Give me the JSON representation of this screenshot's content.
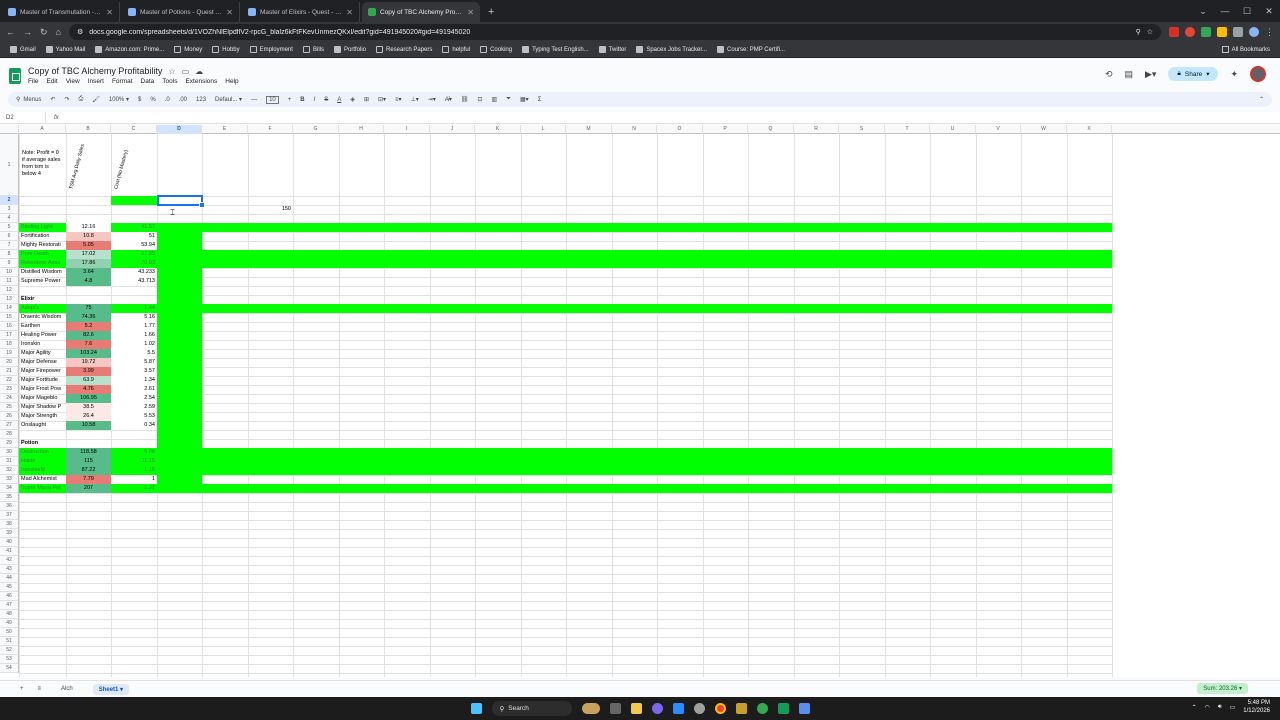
{
  "browser": {
    "tabs": [
      {
        "label": "Master of Transmutation - Que",
        "active": false
      },
      {
        "label": "Master of Potions - Quest - TB",
        "active": false
      },
      {
        "label": "Master of Elixirs - Quest - TBC",
        "active": false
      },
      {
        "label": "Copy of TBC Alchemy Profitabili",
        "active": true
      }
    ],
    "url": "docs.google.com/spreadsheets/d/1VOZhNlElpdflV2-rpcG_blalz6kFtFKevUnmezQKxI/edit?gid=491945020#gid=491945020",
    "bookmarks": [
      "Gmail",
      "Yahoo Mail",
      "Amazon.com: Prime...",
      "Money",
      "Hobby",
      "Employment",
      "Bills",
      "Portfolio",
      "Research Papers",
      "helpful",
      "Cooking",
      "Typing Test English...",
      "Twitter",
      "Spacex Jobs Tracker...",
      "Course: PMP Certifi..."
    ],
    "all_bookmarks": "All Bookmarks"
  },
  "sheets": {
    "title": "Copy of TBC Alchemy Profitability",
    "menu": [
      "File",
      "Edit",
      "View",
      "Insert",
      "Format",
      "Data",
      "Tools",
      "Extensions",
      "Help"
    ],
    "share_label": "Share",
    "toolbar": {
      "menus": "Menus",
      "zoom": "100%",
      "currency": "$",
      "percent": "%",
      "dec_dec": ".0",
      "dec_inc": ".00",
      "numfmt": "123",
      "font": "Defaul...",
      "font_size": "10"
    },
    "name_box": "D2",
    "fx": "fx",
    "columns": [
      "A",
      "B",
      "C",
      "D",
      "E",
      "F",
      "G",
      "H",
      "I",
      "J",
      "K",
      "L",
      "M",
      "N",
      "O",
      "P",
      "Q",
      "R",
      "S",
      "T",
      "U",
      "V",
      "W",
      "X"
    ],
    "headers": {
      "note": [
        "Note: Profit = 0",
        "if average sales",
        "from tsm is",
        "below 4"
      ],
      "b": "TSM Avg Daily Sales",
      "c": "Cost (No Mastery)"
    },
    "f3_value": "150",
    "rows": [
      {
        "r": 5,
        "a": "Binding Light",
        "b": "12.16",
        "c": "41.57"
      },
      {
        "r": 6,
        "a": "Fortification",
        "b": "10.8",
        "c": "51"
      },
      {
        "r": 7,
        "a": "Mighty Restorati",
        "b": "5.05",
        "c": "53.94"
      },
      {
        "r": 8,
        "a": "Pure Death",
        "b": "17.02",
        "c": "57.85"
      },
      {
        "r": 9,
        "a": "Relentless Assa",
        "b": "17.86",
        "c": "70.93"
      },
      {
        "r": 10,
        "a": "Distilled Wisdom",
        "b": "3.64",
        "c": "43.233"
      },
      {
        "r": 11,
        "a": "Supreme Power",
        "b": "4.8",
        "c": "43.713"
      },
      {
        "r": 13,
        "a": "Elixir",
        "b": "",
        "c": ""
      },
      {
        "r": 14,
        "a": "Adept's",
        "b": "75",
        "c": "1.44"
      },
      {
        "r": 15,
        "a": "Draenic Wisdom",
        "b": "74.36",
        "c": "5.16"
      },
      {
        "r": 16,
        "a": "Earthen",
        "b": "5.2",
        "c": "1.77"
      },
      {
        "r": 17,
        "a": "Healing Power",
        "b": "82.6",
        "c": "1.66"
      },
      {
        "r": 18,
        "a": "Ironskin",
        "b": "7.6",
        "c": "1.02"
      },
      {
        "r": 19,
        "a": "Major Agility",
        "b": "103.24",
        "c": "5.5"
      },
      {
        "r": 20,
        "a": "Major Defense",
        "b": "19.72",
        "c": "5.87"
      },
      {
        "r": 21,
        "a": "Major Firepower",
        "b": "3.99",
        "c": "3.57"
      },
      {
        "r": 22,
        "a": "Major Fortitude",
        "b": "63.9",
        "c": "1.34"
      },
      {
        "r": 23,
        "a": "Major Frost Pow",
        "b": "4.76",
        "c": "2.61"
      },
      {
        "r": 24,
        "a": "Major Mageblo",
        "b": "106.95",
        "c": "2.54"
      },
      {
        "r": 25,
        "a": "Major Shadow P",
        "b": "38.5",
        "c": "2.59"
      },
      {
        "r": 26,
        "a": "Major Strength",
        "b": "26.4",
        "c": "5.53"
      },
      {
        "r": 27,
        "a": "Onslaught",
        "b": "10.58",
        "c": "0.34"
      },
      {
        "r": 29,
        "a": "Potion",
        "b": "",
        "c": ""
      },
      {
        "r": 30,
        "a": "Destruction",
        "b": "118.58",
        "c": "5.08"
      },
      {
        "r": 31,
        "a": "Haste",
        "b": "115",
        "c": "11.15"
      },
      {
        "r": 32,
        "a": "Ironshield",
        "b": "87.22",
        "c": "1.16"
      },
      {
        "r": 33,
        "a": "Mad Alchemist",
        "b": "7.79",
        "c": "1"
      },
      {
        "r": 34,
        "a": "Super Mana Pot",
        "b": "207",
        "c": "2.21"
      }
    ],
    "sheet_tabs": [
      {
        "label": "Alch",
        "active": false
      },
      {
        "label": "Sheet1",
        "active": true
      }
    ],
    "sum_label": "Sum: 203.26"
  },
  "taskbar": {
    "search": "Search",
    "time": "5:48 PM",
    "date": "1/12/2026"
  },
  "colors": {
    "bright_green": "#00ff00",
    "green_strong": "#57bb8a",
    "green_light": "#b7e1cd",
    "red": "#e67c73",
    "red_light": "#f4c7c3"
  }
}
